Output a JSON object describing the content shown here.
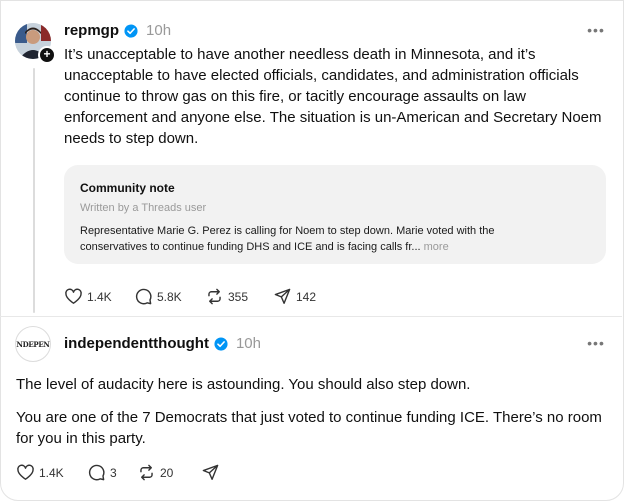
{
  "post1": {
    "username": "repmgp",
    "time": "10h",
    "text": "It’s unacceptable to have another needless death in Minnesota, and it’s unacceptable to have elected officials, candidates, and administration officials continue to throw gas on this fire, or tacitly encourage assaults on law enforcement and anyone else. The situation is un-American and Secretary Noem needs to step down.",
    "community_note": {
      "title": "Community note",
      "subtitle": "Written by a Threads user",
      "body": "Representative Marie G. Perez is calling for Noem to step down. Marie voted with the conservatives to continue funding DHS and ICE and is facing calls fr...",
      "more_label": "more"
    },
    "likes": "1.4K",
    "replies": "5.8K",
    "reposts": "355",
    "shares": "142"
  },
  "post2": {
    "username": "independentthought",
    "time": "10h",
    "avatar_text": "ITINDEPENDE",
    "paragraph1": "The level of audacity here is astounding. You should also step down.",
    "paragraph2": "You are one of the 7 Democrats that just voted to continue funding ICE. There’s no room for you in this party.",
    "likes": "1.4K",
    "replies": "3",
    "reposts": "20"
  },
  "colors": {
    "verified": "#0095f6",
    "muted": "#999999",
    "note_bg": "#f2f2f2"
  }
}
